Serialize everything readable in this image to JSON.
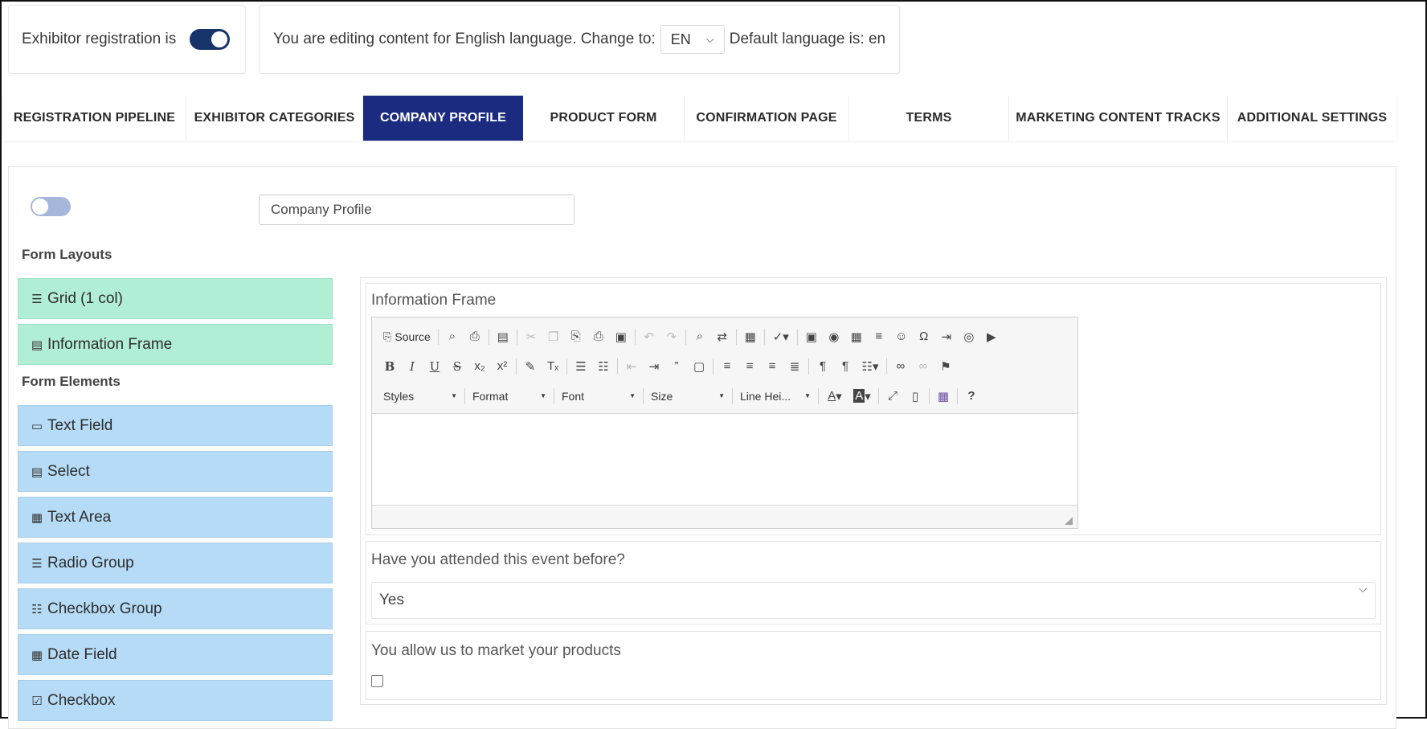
{
  "header": {
    "registration_label": "Exhibitor registration is",
    "language_text": "You are editing content for English language. Change to:",
    "language_value": "EN",
    "default_language_text": "Default language is: en"
  },
  "tabs": [
    {
      "label": "REGISTRATION PIPELINE",
      "active": false
    },
    {
      "label": "EXHIBITOR CATEGORIES",
      "active": false
    },
    {
      "label": "COMPANY PROFILE",
      "active": true
    },
    {
      "label": "PRODUCT FORM",
      "active": false
    },
    {
      "label": "CONFIRMATION PAGE",
      "active": false
    },
    {
      "label": "TERMS",
      "active": false
    },
    {
      "label": "MARKETING CONTENT TRACKS",
      "active": false
    },
    {
      "label": "ADDITIONAL SETTINGS",
      "active": false
    }
  ],
  "form_title_value": "Company Profile",
  "palette": {
    "layouts_label": "Form Layouts",
    "layouts": [
      {
        "label": "Grid (1 col)",
        "icon": "grid-rows-icon"
      },
      {
        "label": "Information Frame",
        "icon": "information-frame-icon"
      }
    ],
    "elements_label": "Form Elements",
    "elements": [
      {
        "label": "Text Field",
        "icon": "text-field-icon"
      },
      {
        "label": "Select",
        "icon": "select-icon"
      },
      {
        "label": "Text Area",
        "icon": "text-area-icon"
      },
      {
        "label": "Radio Group",
        "icon": "radio-group-icon"
      },
      {
        "label": "Checkbox Group",
        "icon": "checkbox-group-icon"
      },
      {
        "label": "Date Field",
        "icon": "calendar-icon"
      },
      {
        "label": "Checkbox",
        "icon": "checkbox-icon"
      }
    ]
  },
  "canvas": {
    "info_frame_label": "Information Frame",
    "editor": {
      "source_label": "Source",
      "styles_label": "Styles",
      "format_label": "Format",
      "font_label": "Font",
      "size_label": "Size",
      "line_height_label": "Line Hei..."
    },
    "question_label": "Have you attended this event before?",
    "question_value": "Yes",
    "marketing_label": "You allow us to market your products"
  },
  "colors": {
    "active_tab": "#1a2b80",
    "toggle_on": "#16346a",
    "layout_item": "#b0eed5",
    "element_item": "#b6dbf6"
  }
}
